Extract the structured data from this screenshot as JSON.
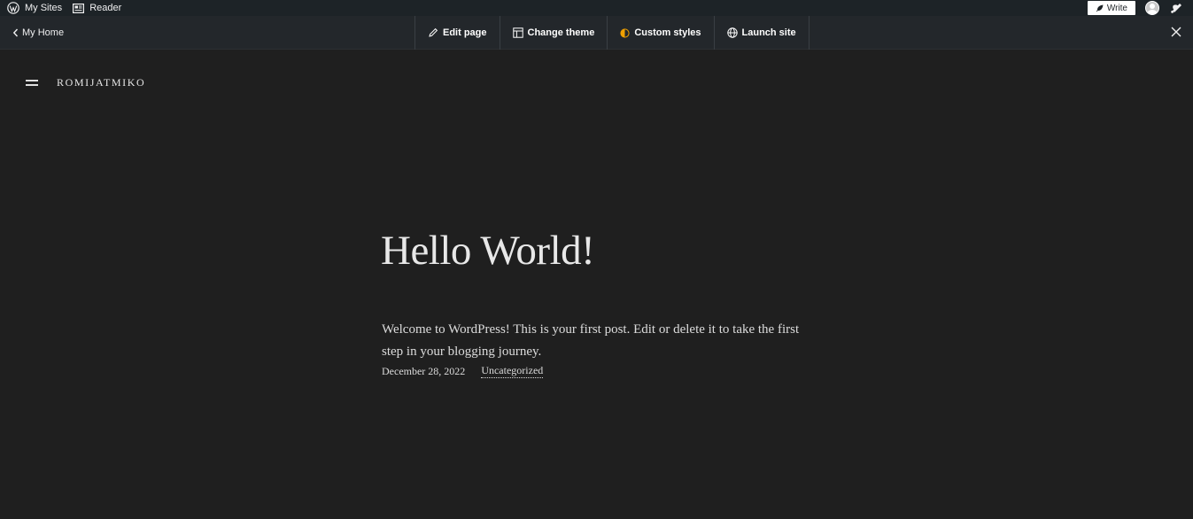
{
  "admin_bar": {
    "my_sites_label": "My Sites",
    "reader_label": "Reader",
    "write_label": "Write"
  },
  "site_bar": {
    "back_label": "My Home",
    "tools": [
      {
        "label": "Edit page",
        "icon": "pencil-icon"
      },
      {
        "label": "Change theme",
        "icon": "layout-icon"
      },
      {
        "label": "Custom styles",
        "icon": "half-circle-icon"
      },
      {
        "label": "Launch site",
        "icon": "globe-icon"
      }
    ],
    "accent_color": "#f0a000"
  },
  "page": {
    "site_title": "ROMIJATMIKO",
    "post_title": "Hello World!",
    "post_body": "Welcome to WordPress! This is your first post. Edit or delete it to take the first step in your blogging journey.",
    "post_date": "December 28, 2022",
    "post_category": "Uncategorized"
  }
}
